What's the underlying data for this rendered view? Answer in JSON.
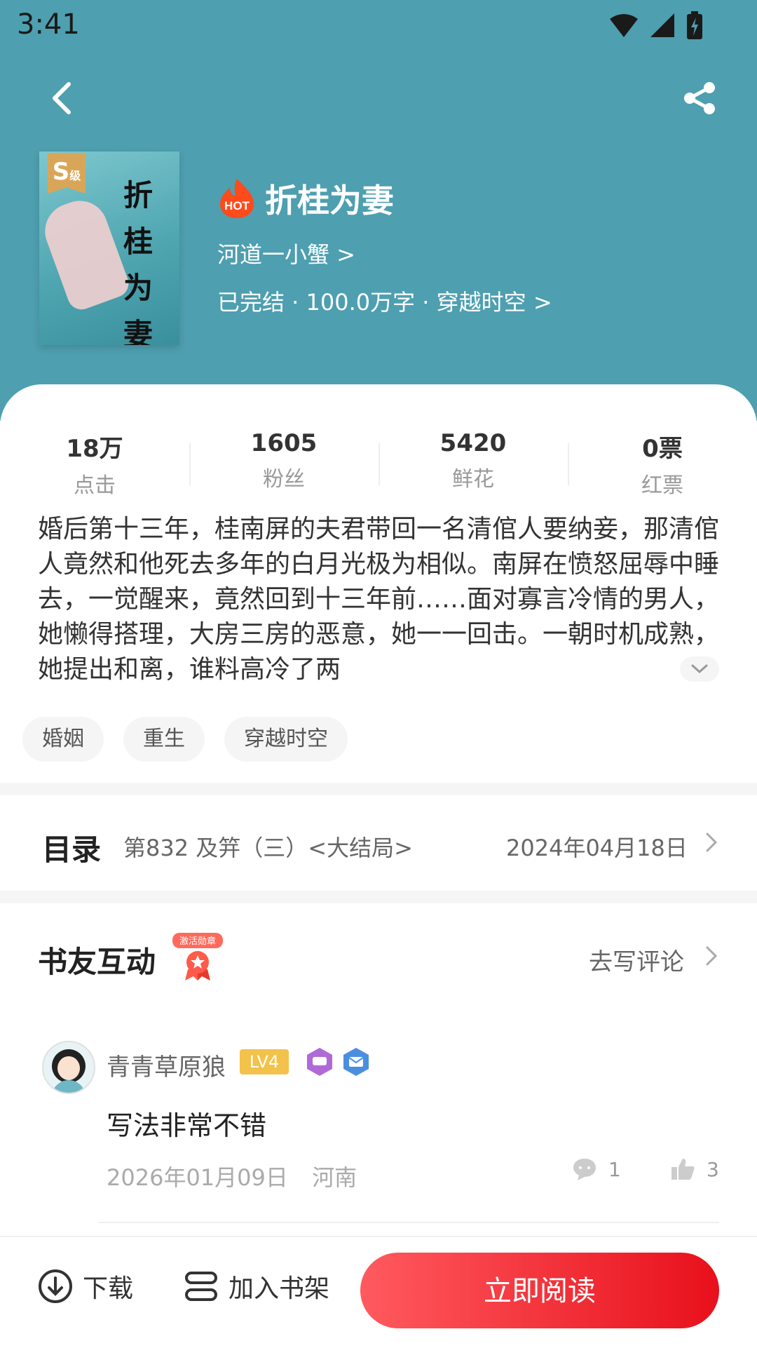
{
  "status_bar": {
    "time": "3:41"
  },
  "book": {
    "cover_title": "折桂为妻",
    "cover_grade": "S",
    "cover_grade_suffix": "级",
    "hot_label": "HOT",
    "title": "折桂为妻",
    "author_link": "河道一小蟹 >",
    "meta_link": "已完结 · 100.0万字 · 穿越时空 >"
  },
  "stats": [
    {
      "value": "18万",
      "label": "点击"
    },
    {
      "value": "1605",
      "label": "粉丝"
    },
    {
      "value": "5420",
      "label": "鲜花"
    },
    {
      "value": "0票",
      "label": "红票"
    }
  ],
  "description": "婚后第十三年，桂南屏的夫君带回一名清倌人要纳妾，那清倌人竟然和他死去多年的白月光极为相似。南屏在愤怒屈辱中睡去，一觉醒来，竟然回到十三年前……面对寡言冷情的男人，她懒得搭理，大房三房的恶意，她一一回击。一朝时机成熟，她提出和离，谁料高冷了两",
  "tags": [
    "婚姻",
    "重生",
    "穿越时空"
  ],
  "toc": {
    "label": "目录",
    "latest_chapter": "第832 及笄（三）<大结局>",
    "date": "2024年04月18日"
  },
  "social": {
    "title": "书友互动",
    "medal_label": "激活勋章",
    "write_comment": "去写评论"
  },
  "comments": [
    {
      "user": "青青草原狼",
      "level": "LV4",
      "text": "写法非常不错",
      "date": "2026年01月09日",
      "location": "河南",
      "replies": "1",
      "likes": "3"
    }
  ],
  "bottom_bar": {
    "download": "下载",
    "add_shelf": "加入书架",
    "read_now": "立即阅读"
  },
  "colors": {
    "header_bg": "#4e9fb0",
    "accent_red": "#e8101b",
    "hot_orange": "#ff4a1c"
  }
}
